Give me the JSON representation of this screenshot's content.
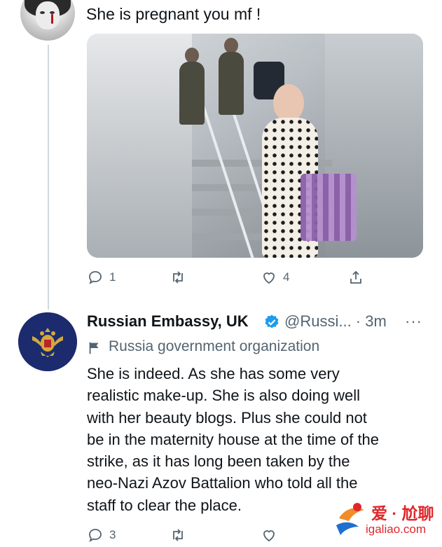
{
  "tweet1": {
    "text": "She is pregnant you mf !",
    "media_alt": "",
    "actions": {
      "reply_count": "1",
      "retweet_count": "",
      "like_count": "4",
      "share": ""
    }
  },
  "tweet2": {
    "author_name": "Russian Embassy, UK",
    "handle_time": "@Russi... · 3m",
    "more": "···",
    "gov_label": "Russia government organization",
    "lines": [
      "She is indeed. As she has some very",
      "realistic make-up. She is also doing well",
      "with her beauty blogs. Plus she could not",
      "be in the maternity house at the time of the",
      "strike, as it has long been taken by the",
      "neo-Nazi Azov Battalion who told all the",
      "staff to clear the place."
    ],
    "actions": {
      "reply_count": "3"
    }
  },
  "watermark": {
    "line1": "爱 · 尬聊",
    "line2": "igaliao.com"
  },
  "colors": {
    "text": "#0f1419",
    "secondary": "#536471",
    "verified": "#1d9bf0",
    "watermark": "#e0272b",
    "embassy_badge": "#1c2b6e"
  },
  "icons": [
    "reply-icon",
    "retweet-icon",
    "like-icon",
    "share-icon",
    "verified-badge-icon",
    "government-flag-icon",
    "embassy-crest-icon",
    "watermark-logo-icon"
  ]
}
